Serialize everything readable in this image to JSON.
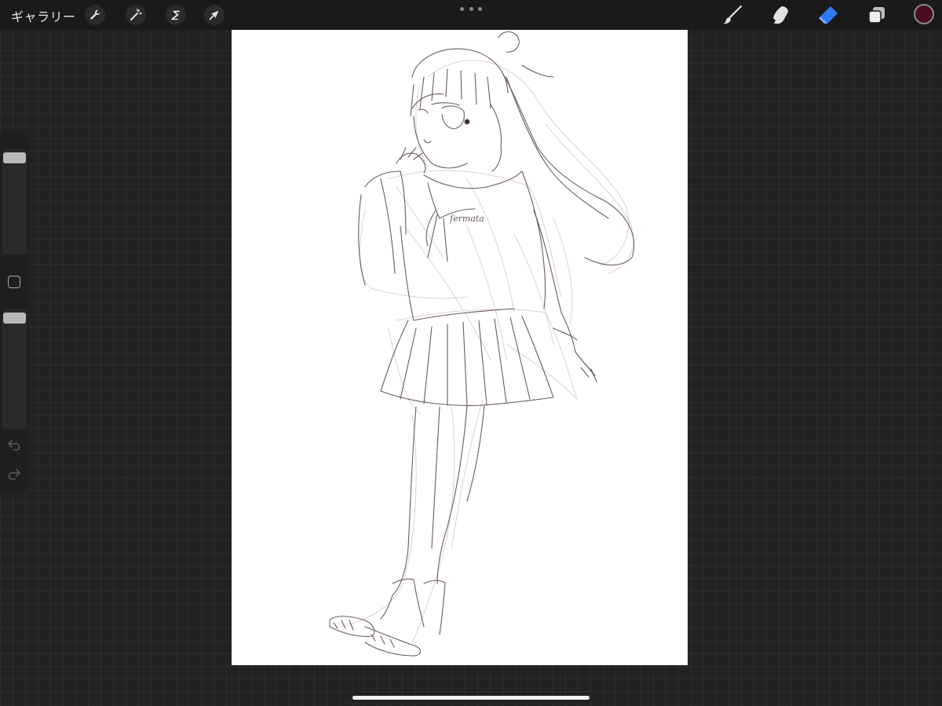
{
  "topbar": {
    "gallery_label": "ギャラリー",
    "left_tools": [
      {
        "name": "actions",
        "icon": "wrench-icon"
      },
      {
        "name": "adjustments",
        "icon": "magic-wand-icon"
      },
      {
        "name": "selection",
        "icon": "selection-s-icon"
      },
      {
        "name": "transform",
        "icon": "arrow-cursor-icon"
      }
    ],
    "center_menu_icon": "more-dots-icon",
    "right_tools": [
      {
        "name": "brush",
        "icon": "paintbrush-icon",
        "active": false
      },
      {
        "name": "smudge",
        "icon": "smudge-finger-icon",
        "active": false
      },
      {
        "name": "eraser",
        "icon": "eraser-icon",
        "active": true
      },
      {
        "name": "layers",
        "icon": "layers-icon",
        "active": false
      }
    ],
    "current_color": "#4a0d1f"
  },
  "sidebar": {
    "brush_size_level": 0.0,
    "opacity_level": 0.0,
    "modify_icon": "square-modify-icon",
    "undo_icon": "undo-icon",
    "redo_icon": "redo-icon"
  },
  "colors": {
    "active_tool": "#2f7bf6",
    "icon": "#d9d9d9",
    "sketch_light": "#d8c4c8",
    "sketch_dark": "#6b5a5f"
  },
  "canvas": {
    "shirt_lettering": "fermata"
  }
}
